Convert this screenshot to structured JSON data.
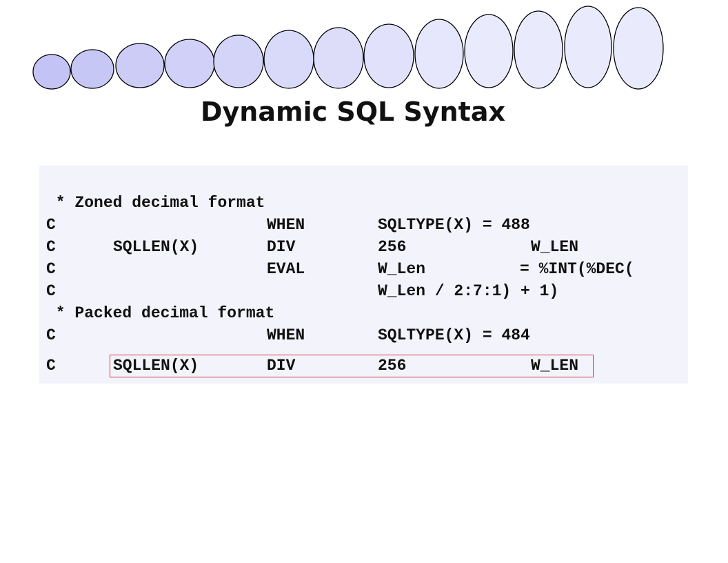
{
  "slide": {
    "title": "Dynamic SQL Syntax",
    "colors": {
      "oval_light": "#eaeafd",
      "oval_dark": "#c3c3f5",
      "oval_stroke": "#000000",
      "panel_bg": "#f3f3fb",
      "highlight_border": "#d32f3a"
    }
  },
  "code": {
    "lines": [
      {
        "c0": " * Zoned decimal format",
        "c1": "",
        "c2": "",
        "c3": "",
        "c4": "",
        "c5": ""
      },
      {
        "c0": "C",
        "c1": "",
        "c2": "WHEN",
        "c3": "SQLTYPE(X) = 488",
        "c4": "",
        "c5": ""
      },
      {
        "c0": "C",
        "c1": "SQLLEN(X)",
        "c2": "DIV",
        "c3": "256",
        "c4": "W_LEN",
        "c5": ""
      },
      {
        "c0": "C",
        "c1": "",
        "c2": "EVAL",
        "c3": "W_Len",
        "c4": "= %INT(%DEC(",
        "c5": ""
      },
      {
        "c0": "C",
        "c1": "",
        "c2": "",
        "c3": "W_Len / 2:7:1) + 1)",
        "c4": "",
        "c5": ""
      },
      {
        "c0": " * Packed decimal format",
        "c1": "",
        "c2": "",
        "c3": "",
        "c4": "",
        "c5": ""
      },
      {
        "c0": "C",
        "c1": "",
        "c2": "WHEN",
        "c3": "SQLTYPE(X) = 484",
        "c4": "",
        "c5": ""
      },
      {
        "c0": "C",
        "c1": "SQLLEN(X)",
        "c2": "DIV",
        "c3": "256",
        "c4": "W_LEN",
        "c5": ""
      }
    ]
  }
}
